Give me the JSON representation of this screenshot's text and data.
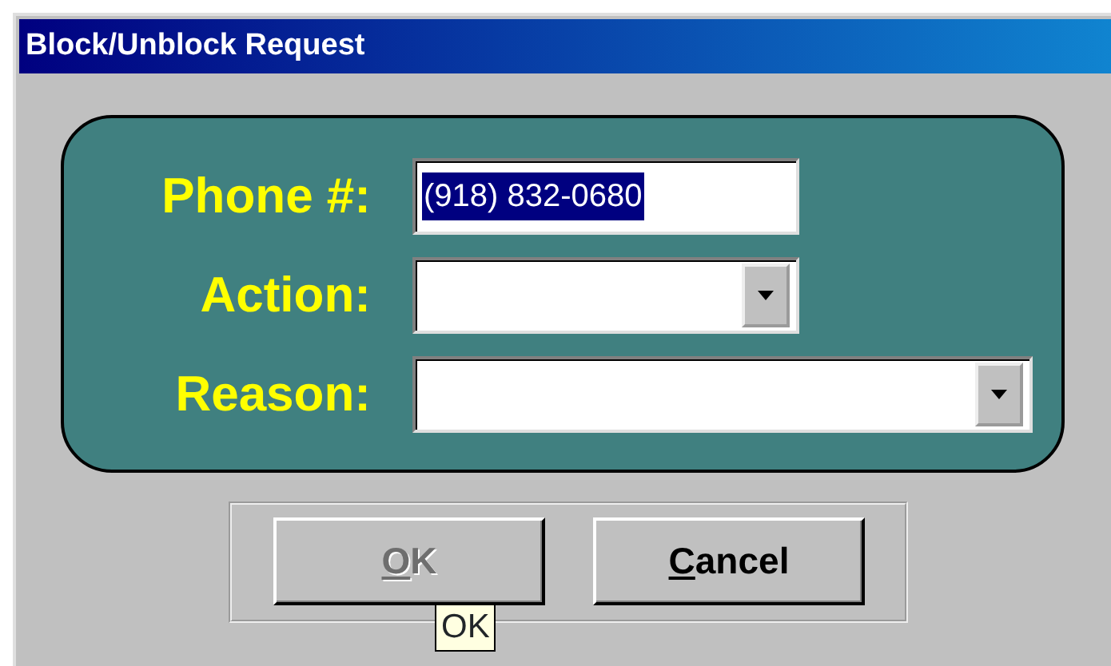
{
  "window": {
    "title": "Block/Unblock Request"
  },
  "fields": [
    {
      "kind": "text",
      "label": "Phone #:",
      "value": "(918) 832-0680",
      "text_selected": true
    },
    {
      "kind": "dropdown",
      "label": "Action:",
      "wide": false
    },
    {
      "kind": "dropdown",
      "label": "Reason:",
      "wide": true
    }
  ],
  "buttons": [
    {
      "access_key": "O",
      "rest": "K",
      "disabled": true
    },
    {
      "access_key": "C",
      "rest": "ancel",
      "disabled": false
    }
  ],
  "tooltip": {
    "text": "OK"
  }
}
